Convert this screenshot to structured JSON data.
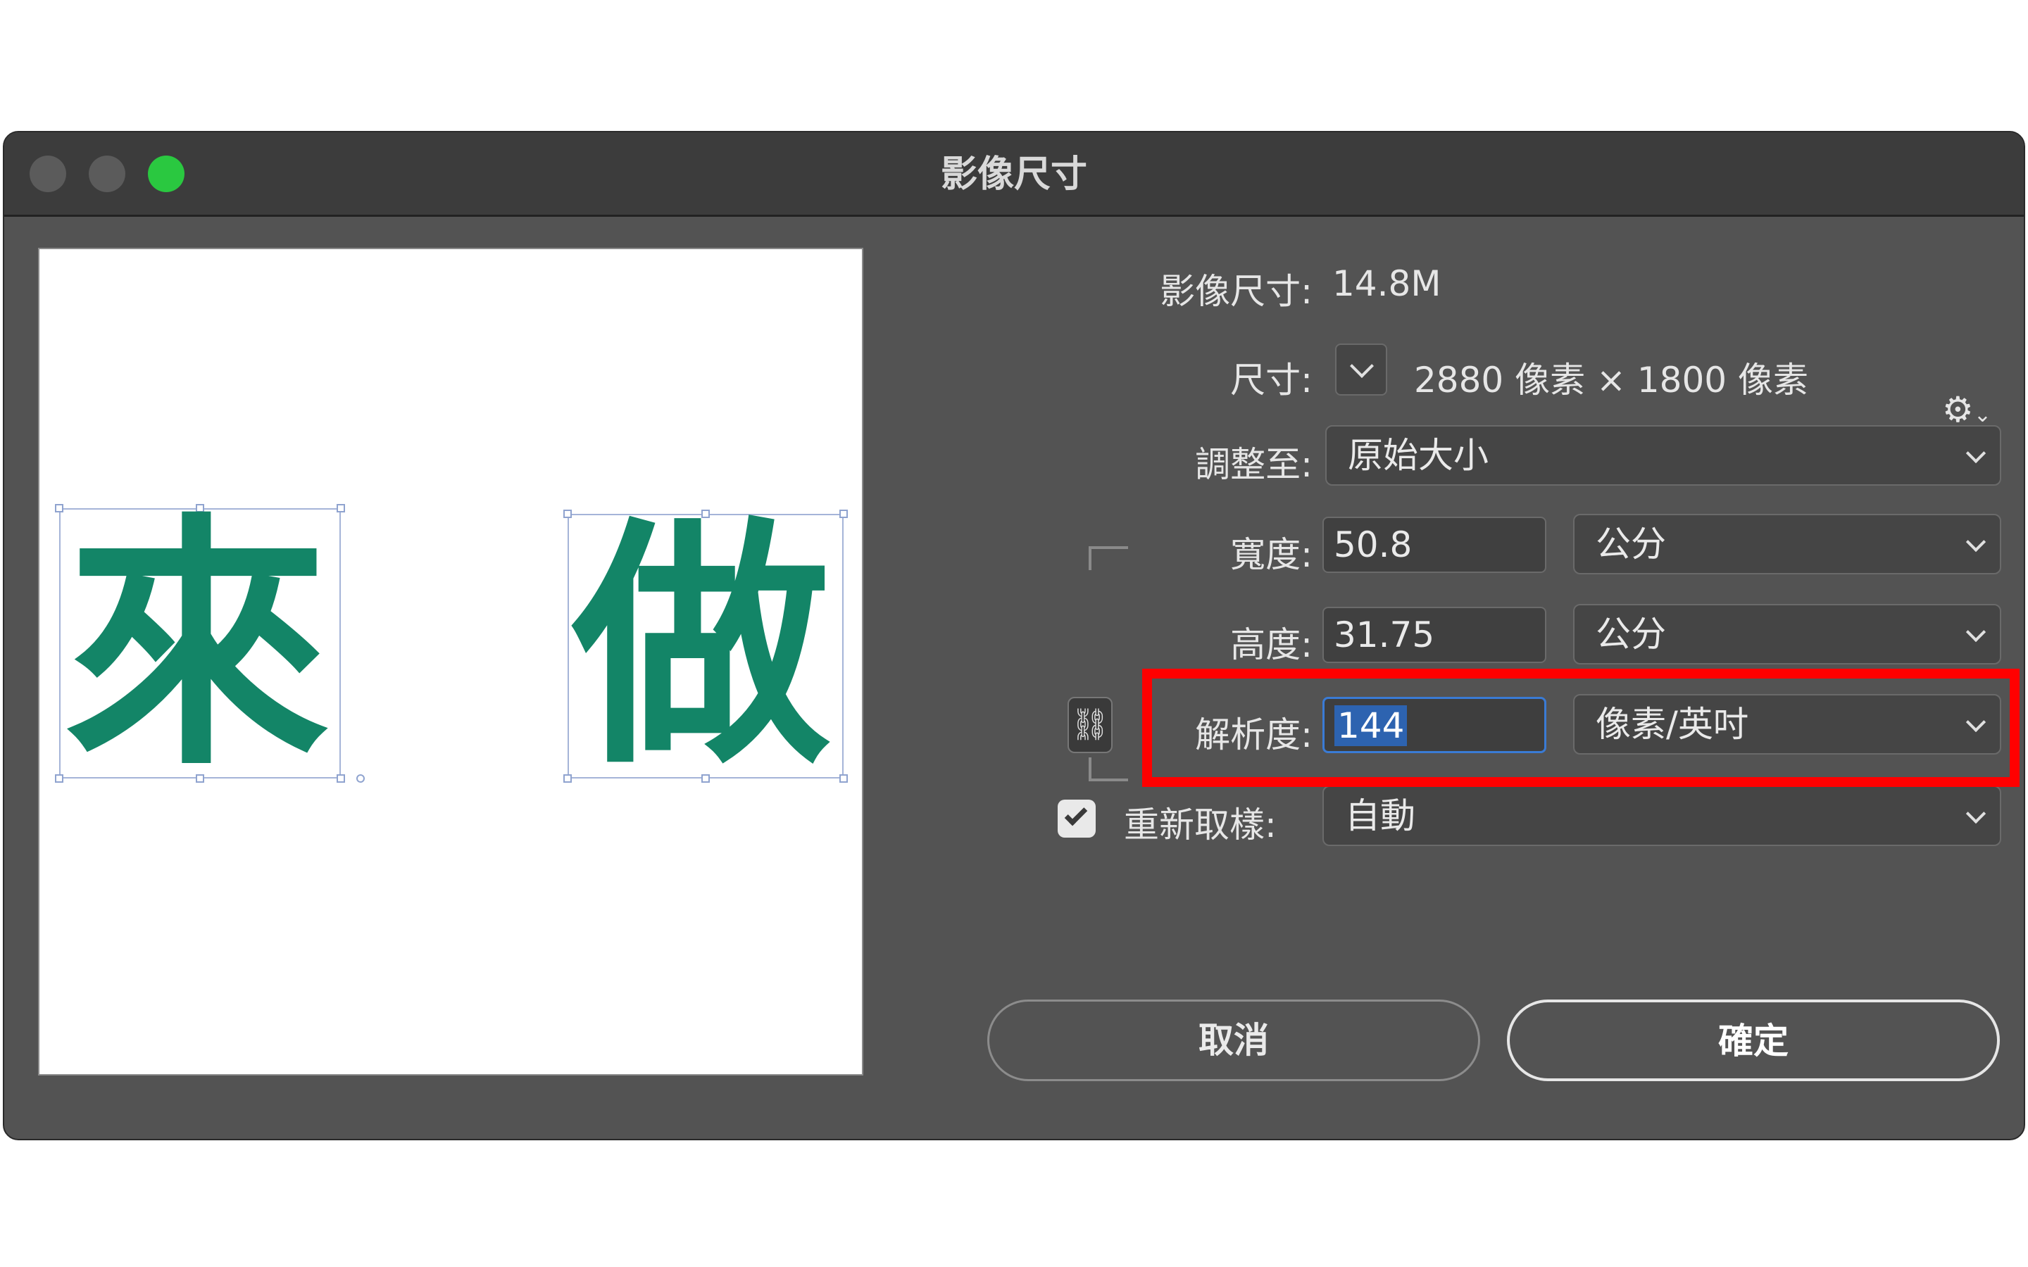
{
  "window": {
    "title": "影像尺寸"
  },
  "preview": {
    "glyph_left": "來",
    "glyph_right": "做"
  },
  "info": {
    "image_size_label": "影像尺寸:",
    "image_size_value": "14.8M",
    "dimensions_label": "尺寸:",
    "dimensions_value": "2880 像素  ×  1800 像素"
  },
  "fit_to": {
    "label": "調整至:",
    "selected": "原始大小"
  },
  "width": {
    "label": "寬度:",
    "value": "50.8",
    "unit": "公分"
  },
  "height": {
    "label": "高度:",
    "value": "31.75",
    "unit": "公分"
  },
  "resolution": {
    "label": "解析度:",
    "value": "144",
    "unit": "像素/英吋"
  },
  "resample": {
    "label": "重新取樣:",
    "checked": true,
    "selected": "自動"
  },
  "buttons": {
    "cancel": "取消",
    "ok": "確定"
  },
  "icons": {
    "gear": "gear-icon",
    "chain": "link-icon"
  },
  "colors": {
    "highlight": "#ff0000",
    "glyph": "#138567",
    "selection": "#2d63b0"
  }
}
